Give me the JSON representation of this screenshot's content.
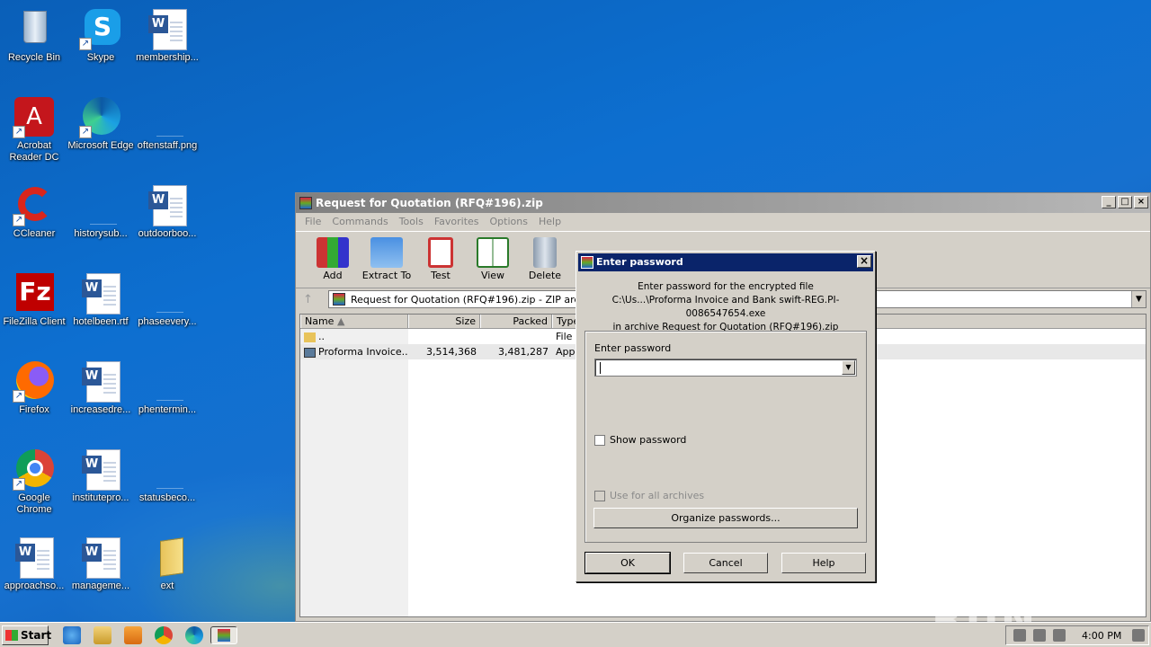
{
  "desktop": {
    "icons": [
      {
        "label": "Recycle Bin"
      },
      {
        "label": "Skype"
      },
      {
        "label": "membership..."
      },
      {
        "label": "Acrobat Reader DC"
      },
      {
        "label": "Microsoft Edge"
      },
      {
        "label": "oftenstaff.png"
      },
      {
        "label": "CCleaner"
      },
      {
        "label": "historysub..."
      },
      {
        "label": "outdoorboo..."
      },
      {
        "label": "FileZilla Client"
      },
      {
        "label": "hotelbeen.rtf"
      },
      {
        "label": "phaseevery..."
      },
      {
        "label": "Firefox"
      },
      {
        "label": "increasedre..."
      },
      {
        "label": "phentermin..."
      },
      {
        "label": "Google Chrome"
      },
      {
        "label": "institutepro..."
      },
      {
        "label": "statusbeco..."
      },
      {
        "label": "approachso..."
      },
      {
        "label": "manageme..."
      },
      {
        "label": "ext"
      }
    ]
  },
  "winrar": {
    "title": "Request for Quotation (RFQ#196).zip",
    "menu": [
      "File",
      "Commands",
      "Tools",
      "Favorites",
      "Options",
      "Help"
    ],
    "toolbar": [
      "Add",
      "Extract To",
      "Test",
      "View",
      "Delete"
    ],
    "address": "Request for Quotation (RFQ#196).zip - ZIP arch",
    "columns": [
      "Name",
      "Size",
      "Packed",
      "Type"
    ],
    "rows": [
      {
        "name": "..",
        "size": "",
        "packed": "",
        "type": "File f"
      },
      {
        "name": "Proforma Invoice...",
        "size": "3,514,368",
        "packed": "3,481,287",
        "type": "Appl"
      }
    ]
  },
  "dialog": {
    "title": "Enter password",
    "msg_line1": "Enter password for the encrypted file",
    "msg_line2": "C:\\Us...\\Proforma Invoice and Bank swift-REG.PI-0086547654.exe",
    "msg_line3": "in archive Request for Quotation (RFQ#196).zip",
    "field_label": "Enter password",
    "password_value": "",
    "show_password": "Show password",
    "use_for_all": "Use for all archives",
    "organize": "Organize passwords...",
    "ok": "OK",
    "cancel": "Cancel",
    "help": "Help"
  },
  "taskbar": {
    "start": "Start",
    "clock": "4:00 PM"
  },
  "watermark": "ANY RUN"
}
